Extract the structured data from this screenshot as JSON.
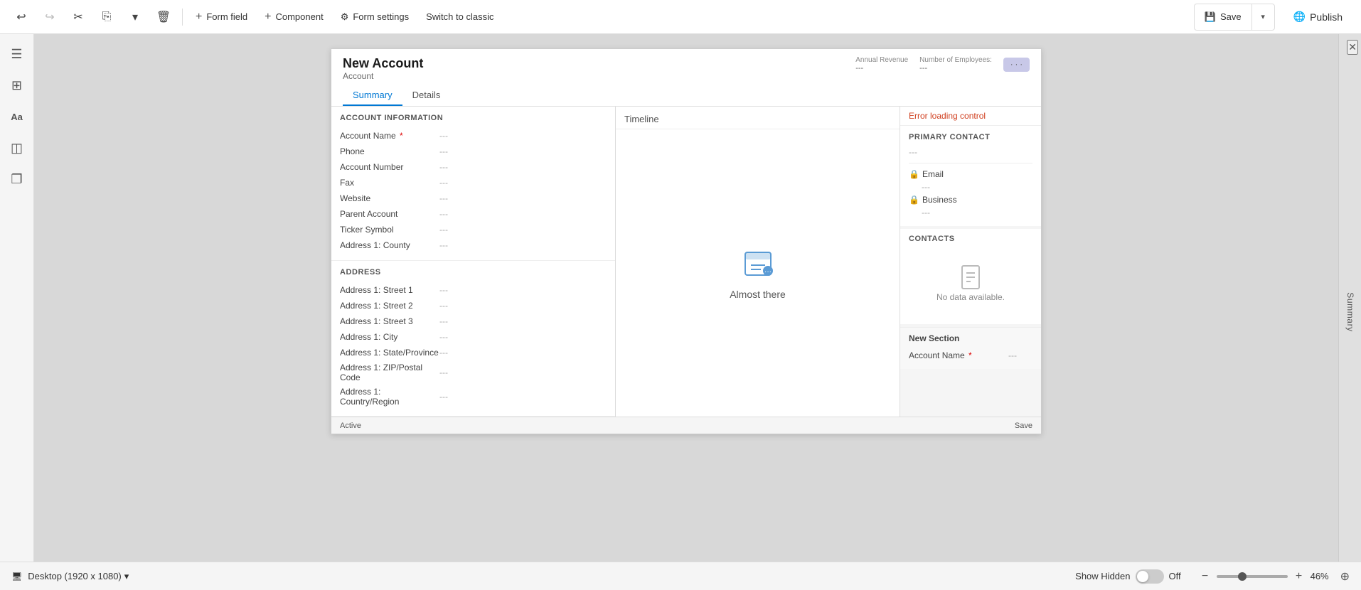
{
  "toolbar": {
    "undo_label": "↩",
    "redo_label": "↪",
    "cut_label": "✂",
    "copy_label": "⎘",
    "dropdown_label": "▾",
    "delete_label": "🗑",
    "form_field_label": "Form field",
    "component_label": "Component",
    "form_settings_label": "Form settings",
    "switch_classic_label": "Switch to classic",
    "save_label": "Save",
    "publish_label": "Publish"
  },
  "sidebar": {
    "items": [
      {
        "id": "menu",
        "icon": "☰"
      },
      {
        "id": "grid",
        "icon": "⊞"
      },
      {
        "id": "text",
        "icon": "Aa"
      },
      {
        "id": "layers",
        "icon": "◫"
      },
      {
        "id": "pages",
        "icon": "❐"
      }
    ]
  },
  "form": {
    "title": "New Account",
    "subtitle": "Account",
    "stats": [
      {
        "label": "Annual Revenue",
        "value": "---"
      },
      {
        "label": "Number of Employees:",
        "value": "---"
      }
    ],
    "tabs": [
      {
        "id": "summary",
        "label": "Summary",
        "active": true
      },
      {
        "id": "details",
        "label": "Details",
        "active": false
      }
    ],
    "sections": {
      "account_info": {
        "title": "ACCOUNT INFORMATION",
        "fields": [
          {
            "label": "Account Name",
            "required": true,
            "value": "---"
          },
          {
            "label": "Phone",
            "required": false,
            "value": "---"
          },
          {
            "label": "Account Number",
            "required": false,
            "value": "---"
          },
          {
            "label": "Fax",
            "required": false,
            "value": "---"
          },
          {
            "label": "Website",
            "required": false,
            "value": "---"
          },
          {
            "label": "Parent Account",
            "required": false,
            "value": "---"
          },
          {
            "label": "Ticker Symbol",
            "required": false,
            "value": "---"
          },
          {
            "label": "Address 1: County",
            "required": false,
            "value": "---"
          }
        ]
      },
      "address": {
        "title": "ADDRESS",
        "fields": [
          {
            "label": "Address 1: Street 1",
            "required": false,
            "value": "---"
          },
          {
            "label": "Address 1: Street 2",
            "required": false,
            "value": "---"
          },
          {
            "label": "Address 1: Street 3",
            "required": false,
            "value": "---"
          },
          {
            "label": "Address 1: City",
            "required": false,
            "value": "---"
          },
          {
            "label": "Address 1: State/Province",
            "required": false,
            "value": "---"
          },
          {
            "label": "Address 1: ZIP/Postal Code",
            "required": false,
            "value": "---"
          },
          {
            "label": "Address 1: Country/Region",
            "required": false,
            "value": "---"
          }
        ]
      },
      "timeline": {
        "title": "Timeline",
        "almost_there": "Almost there"
      },
      "error": {
        "text": "Error loading control"
      },
      "primary_contact": {
        "title": "Primary Contact",
        "value": "---",
        "email_label": "Email",
        "email_value": "---",
        "business_label": "Business",
        "business_value": "---"
      },
      "contacts": {
        "title": "CONTACTS",
        "no_data": "No data available."
      },
      "new_section": {
        "title": "New Section",
        "fields": [
          {
            "label": "Account Name",
            "required": true,
            "value": "---"
          }
        ]
      }
    },
    "status": {
      "active": "Active",
      "save": "Save"
    }
  },
  "right_panel": {
    "label": "Summary",
    "close": "✕"
  },
  "bottom_bar": {
    "desktop_label": "Desktop (1920 x 1080)",
    "show_hidden_label": "Show Hidden",
    "toggle_state": "Off",
    "zoom_percent": "46%"
  }
}
